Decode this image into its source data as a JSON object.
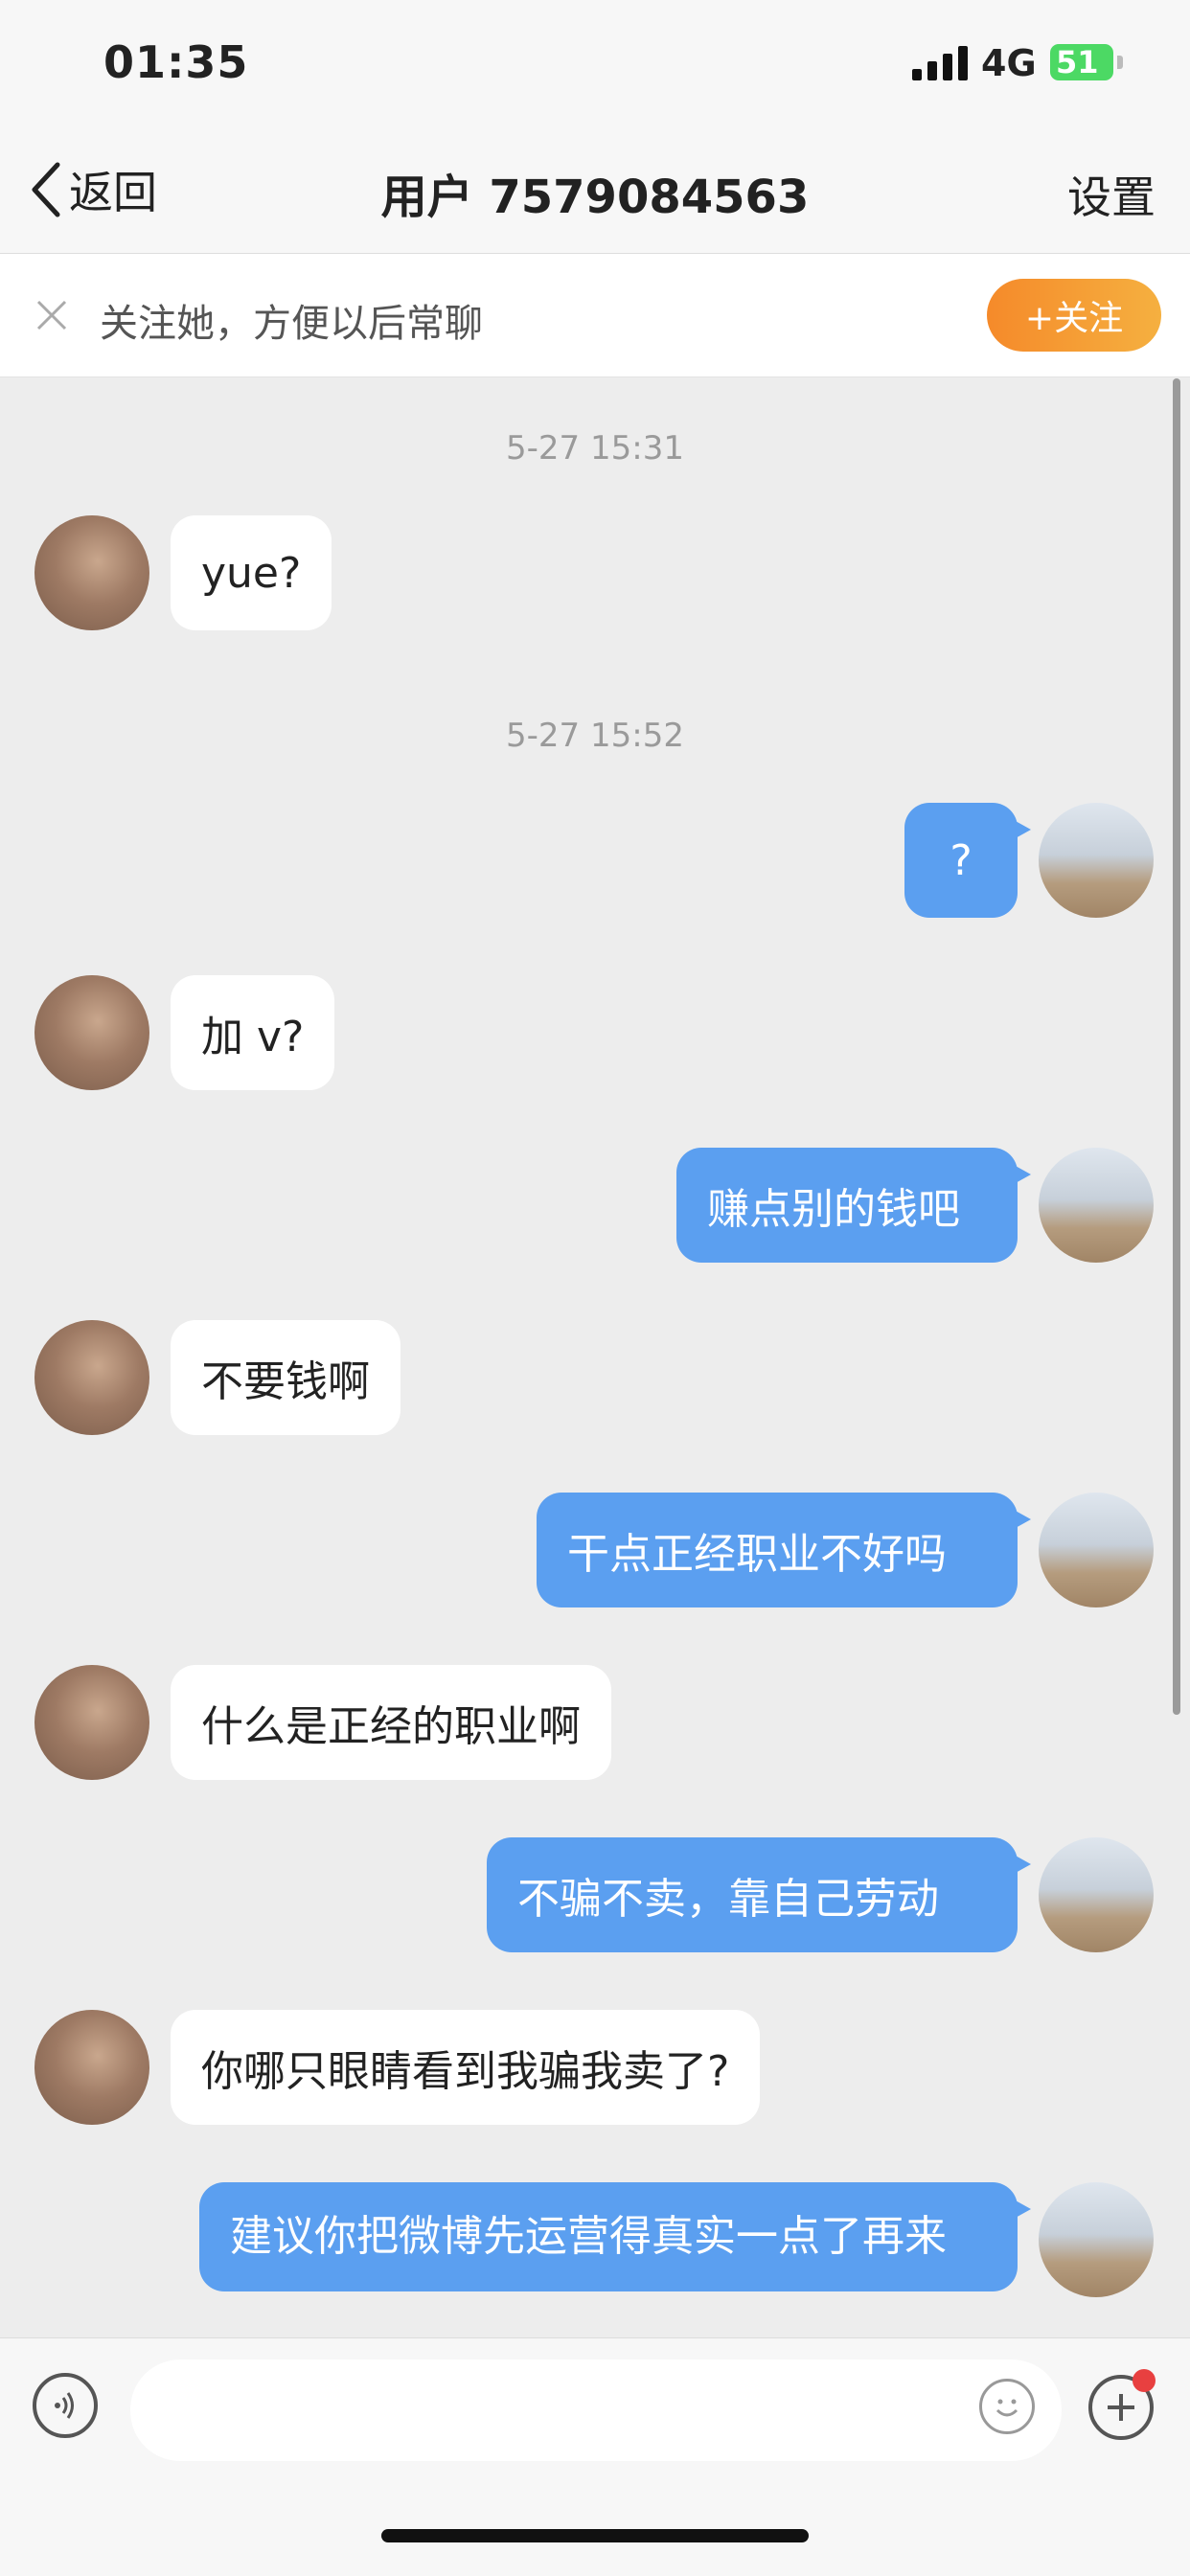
{
  "status_bar": {
    "time": "01:35",
    "network": "4G",
    "battery": "51"
  },
  "nav": {
    "back_label": "返回",
    "title": "用户 7579084563",
    "settings_label": "设置"
  },
  "follow_banner": {
    "text": "关注她，方便以后常聊",
    "button_label": "+关注"
  },
  "messages": [
    {
      "kind": "time",
      "text": "5-27 15:31"
    },
    {
      "kind": "in",
      "text": "yue?"
    },
    {
      "kind": "time",
      "text": "5-27 15:52"
    },
    {
      "kind": "out",
      "text": "?"
    },
    {
      "kind": "in",
      "text": "加 v?"
    },
    {
      "kind": "out",
      "text": "赚点别的钱吧"
    },
    {
      "kind": "in",
      "text": "不要钱啊"
    },
    {
      "kind": "out",
      "text": "干点正经职业不好吗"
    },
    {
      "kind": "in",
      "text": "什么是正经的职业啊"
    },
    {
      "kind": "out",
      "text": "不骗不卖，靠自己劳动"
    },
    {
      "kind": "in",
      "text": "你哪只眼睛看到我骗我卖了?"
    },
    {
      "kind": "out",
      "text": "建议你把微博先运营得真实一点了再来"
    }
  ],
  "icons": {
    "voice": "voice-icon",
    "emoji": "emoji-icon",
    "plus": "plus-icon",
    "close": "close-icon",
    "back": "chevron-left-icon"
  },
  "colors": {
    "outgoing_bubble": "#5b9ff0",
    "follow_button": "#f5a03a",
    "background": "#ededed"
  }
}
